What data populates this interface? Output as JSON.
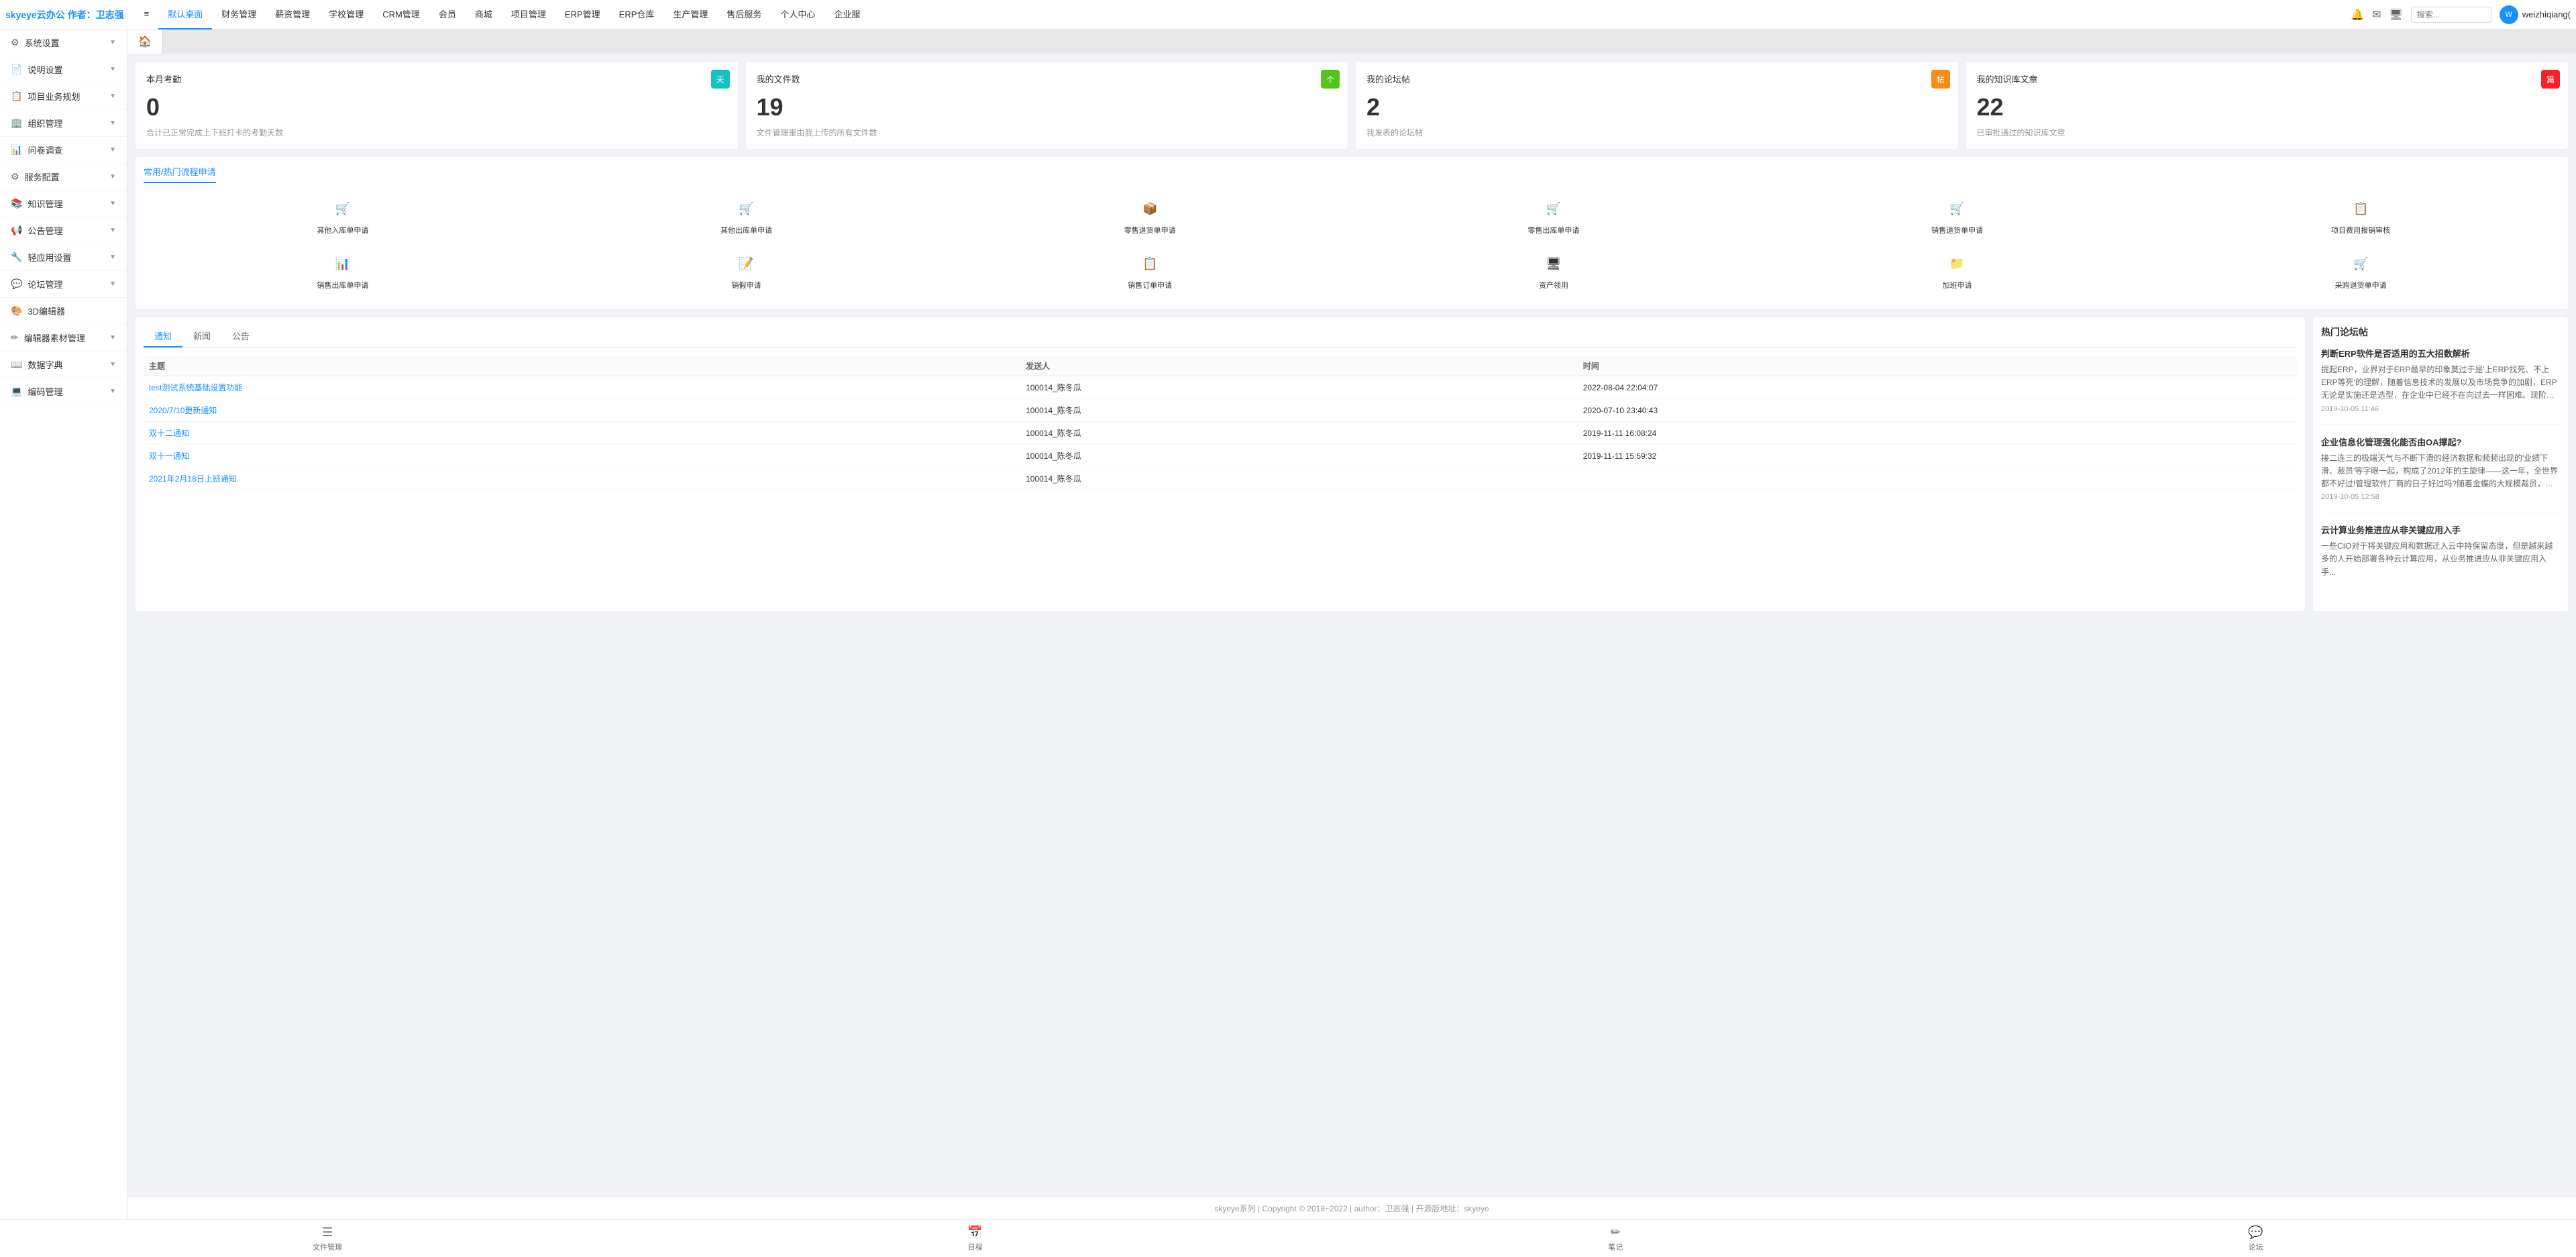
{
  "brand": "skyeye云办公 作者：卫志强",
  "topnav": {
    "items": [
      {
        "label": "≡",
        "id": "menu"
      },
      {
        "label": "默认桌面",
        "id": "home",
        "active": true
      },
      {
        "label": "财务管理",
        "id": "finance"
      },
      {
        "label": "薪资管理",
        "id": "salary"
      },
      {
        "label": "学校管理",
        "id": "school"
      },
      {
        "label": "CRM管理",
        "id": "crm"
      },
      {
        "label": "会员",
        "id": "member"
      },
      {
        "label": "商城",
        "id": "shop"
      },
      {
        "label": "项目管理",
        "id": "project"
      },
      {
        "label": "ERP管理",
        "id": "erp"
      },
      {
        "label": "ERP仓库",
        "id": "erp-warehouse"
      },
      {
        "label": "生产管理",
        "id": "production"
      },
      {
        "label": "售后服务",
        "id": "aftersale"
      },
      {
        "label": "个人中心",
        "id": "personal"
      },
      {
        "label": "企业服",
        "id": "enterprise"
      }
    ],
    "search_placeholder": "搜索...",
    "username": "weizhiqiang("
  },
  "sidebar": {
    "items": [
      {
        "icon": "⚙",
        "label": "系统设置",
        "has_arrow": true
      },
      {
        "icon": "📄",
        "label": "说明设置",
        "has_arrow": true
      },
      {
        "icon": "📋",
        "label": "项目业务规划",
        "has_arrow": true
      },
      {
        "icon": "🏢",
        "label": "组织管理",
        "has_arrow": true
      },
      {
        "icon": "📊",
        "label": "问卷调查",
        "has_arrow": true
      },
      {
        "icon": "⚙",
        "label": "服务配置",
        "has_arrow": true
      },
      {
        "icon": "📚",
        "label": "知识管理",
        "has_arrow": true
      },
      {
        "icon": "📢",
        "label": "公告管理",
        "has_arrow": true
      },
      {
        "icon": "🔧",
        "label": "轻应用设置",
        "has_arrow": true
      },
      {
        "icon": "💬",
        "label": "论坛管理",
        "has_arrow": true
      },
      {
        "icon": "🎨",
        "label": "3D编辑器",
        "has_arrow": false
      },
      {
        "icon": "✏",
        "label": "编辑器素材管理",
        "has_arrow": true
      },
      {
        "icon": "📖",
        "label": "数据字典",
        "has_arrow": true
      },
      {
        "icon": "💻",
        "label": "编码管理",
        "has_arrow": true
      }
    ]
  },
  "tabs": [
    {
      "label": "🏠",
      "id": "home-tab",
      "active": true
    }
  ],
  "stats": [
    {
      "title": "本月考勤",
      "badge_text": "天",
      "badge_color": "badge-teal",
      "number": "0",
      "desc": "合计已正常完成上下班打卡的考勤天数"
    },
    {
      "title": "我的文件数",
      "badge_text": "个",
      "badge_color": "badge-green",
      "number": "19",
      "desc": "文件管理里由我上传的所有文件数"
    },
    {
      "title": "我的论坛帖",
      "badge_text": "帖",
      "badge_color": "badge-orange",
      "number": "2",
      "desc": "我发表的论坛帖"
    },
    {
      "title": "我的知识库文章",
      "badge_text": "篇",
      "badge_color": "badge-red",
      "number": "22",
      "desc": "已审批通过的知识库文章"
    }
  ],
  "workflow": {
    "title": "常用/热门流程申请",
    "rows": [
      [
        {
          "icon": "🛒",
          "label": "其他入库单申请",
          "icon_color": "#f5222d"
        },
        {
          "icon": "🛒",
          "label": "其他出库单申请",
          "icon_color": "#f5222d"
        },
        {
          "icon": "📦",
          "label": "零售退货单申请",
          "icon_color": "#f5222d"
        },
        {
          "icon": "🛒",
          "label": "零售出库单申请",
          "icon_color": "#722ed1"
        },
        {
          "icon": "🛒",
          "label": "销售退货单申请",
          "icon_color": "#1890ff"
        },
        {
          "icon": "📋",
          "label": "项目费用报销审核",
          "icon_color": "#1890ff"
        }
      ],
      [
        {
          "icon": "📊",
          "label": "销售出库单申请",
          "icon_color": "#722ed1"
        },
        {
          "icon": "📝",
          "label": "销假申请",
          "icon_color": "#333"
        },
        {
          "icon": "📋",
          "label": "销售订单申请",
          "icon_color": "#f5222d"
        },
        {
          "icon": "🖥",
          "label": "资产领用",
          "icon_color": "#333"
        },
        {
          "icon": "📁",
          "label": "加班申请",
          "icon_color": "#333"
        },
        {
          "icon": "🛒",
          "label": "采购退货单申请",
          "icon_color": "#13c2c2"
        }
      ]
    ]
  },
  "notifications": {
    "tabs": [
      "通知",
      "新闻",
      "公告"
    ],
    "active_tab": "通知",
    "columns": [
      "主题",
      "发送人",
      "时间"
    ],
    "rows": [
      {
        "subject": "test测试系统基础设置功能",
        "sender": "100014_陈冬瓜",
        "time": "2022-08-04 22:04:07"
      },
      {
        "subject": "2020/7/10更新通知",
        "sender": "100014_陈冬瓜",
        "time": "2020-07-10 23:40:43"
      },
      {
        "subject": "双十二通知",
        "sender": "100014_陈冬瓜",
        "time": "2019-11-11 16:08:24"
      },
      {
        "subject": "双十一通知",
        "sender": "100014_陈冬瓜",
        "time": "2019-11-11 15:59:32"
      },
      {
        "subject": "2021年2月18日上班通知",
        "sender": "100014_陈冬瓜",
        "time": ""
      }
    ]
  },
  "forum": {
    "title": "热门论坛帖",
    "posts": [
      {
        "title": "判断ERP软件是否适用的五大招数解析",
        "excerpt": "提起ERP，业界对于ERP最早的印象莫过于是'上ERP找死、不上ERP等死'的理解，随着信息技术的发展以及市场竞争的加剧，ERP无论是实施还是选型，在企业中已经不在向过去一样困难。现阶段，传统的ERP服务商无论是从产品方面，还是从服务方面都已经更...",
        "date": "2019-10-05 11:46"
      },
      {
        "title": "企业信息化管理强化能否由OA撑起?",
        "excerpt": "接二连三的极端天气与不断下滑的经济数据和频频出现的'业绩下滑、裁员'等字眼一起，构成了2012年的主旋律——这一年，全世界都不好过!管理软件厂商的日子好过吗?随着金蝶的大规模裁员，如果仅仅裁员倒也罢了，其背后面着的财报加上堪忧的经济形势则更让...",
        "date": "2019-10-05 12:58"
      },
      {
        "title": "云计算业务推进应从非关键应用入手",
        "excerpt": "一些CIO对于将关键应用和数据迁入云中持保留态度，但是越来越多的人开始部署各种云计算应用，从业务推进应从非关键应用入手...",
        "date": ""
      }
    ]
  },
  "footer": {
    "text": "skyeye系列 | Copyright © 2018~2022 | author：卫志强 | 开源版地址：skyeye"
  },
  "bottom_toolbar": {
    "items": [
      {
        "icon": "☰",
        "label": "文件管理"
      },
      {
        "icon": "📅",
        "label": "日程"
      },
      {
        "icon": "✏",
        "label": "笔记"
      },
      {
        "icon": "💬",
        "label": "论坛"
      }
    ]
  }
}
